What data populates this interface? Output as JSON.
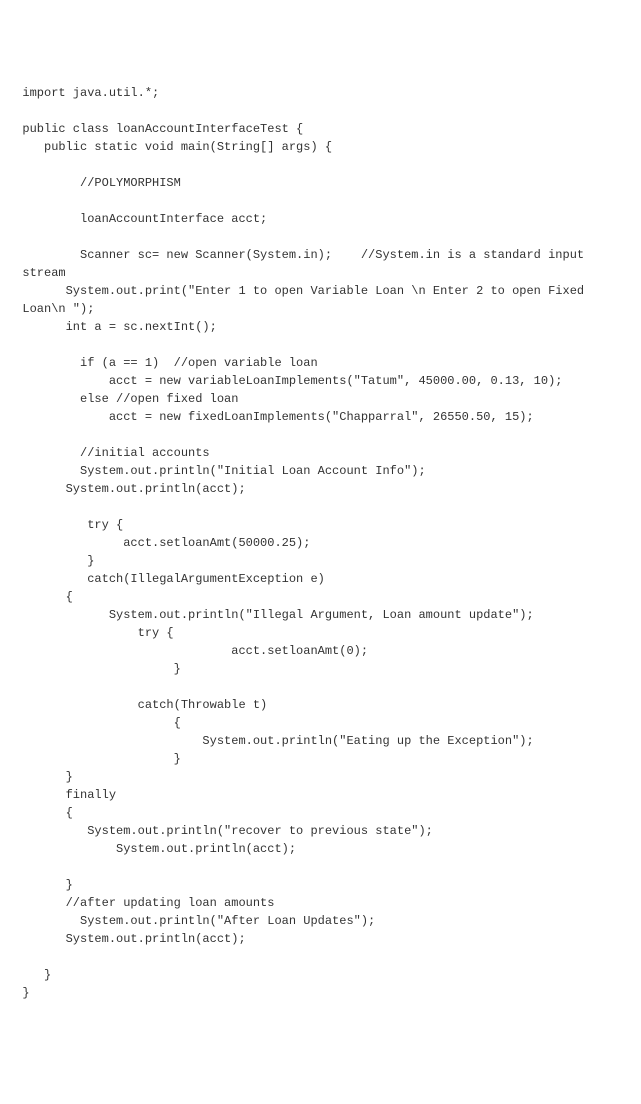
{
  "code": {
    "lines": [
      "  import java.util.*;",
      "",
      "  public class loanAccountInterfaceTest {",
      "     public static void main(String[] args) {",
      "",
      "          //POLYMORPHISM",
      "",
      "          loanAccountInterface acct;",
      "",
      "          Scanner sc= new Scanner(System.in);    //System.in is a standard input",
      "  stream",
      "        System.out.print(\"Enter 1 to open Variable Loan \\n Enter 2 to open Fixed",
      "  Loan\\n \");",
      "        int a = sc.nextInt();",
      "",
      "          if (a == 1)  //open variable loan",
      "              acct = new variableLoanImplements(\"Tatum\", 45000.00, 0.13, 10);",
      "          else //open fixed loan",
      "              acct = new fixedLoanImplements(\"Chapparral\", 26550.50, 15);",
      "",
      "          //initial accounts",
      "          System.out.println(\"Initial Loan Account Info\");",
      "        System.out.println(acct);",
      "",
      "           try {",
      "                acct.setloanAmt(50000.25);",
      "           }",
      "           catch(IllegalArgumentException e)",
      "        {",
      "              System.out.println(\"Illegal Argument, Loan amount update\");",
      "                  try {",
      "                               acct.setloanAmt(0);",
      "                       }",
      "",
      "                  catch(Throwable t)",
      "                       {",
      "                           System.out.println(\"Eating up the Exception\");",
      "                       }",
      "        }",
      "        finally",
      "        {",
      "           System.out.println(\"recover to previous state\");",
      "               System.out.println(acct);",
      "",
      "        }",
      "        //after updating loan amounts",
      "          System.out.println(\"After Loan Updates\");",
      "        System.out.println(acct);",
      "",
      "     }",
      "  }"
    ]
  }
}
